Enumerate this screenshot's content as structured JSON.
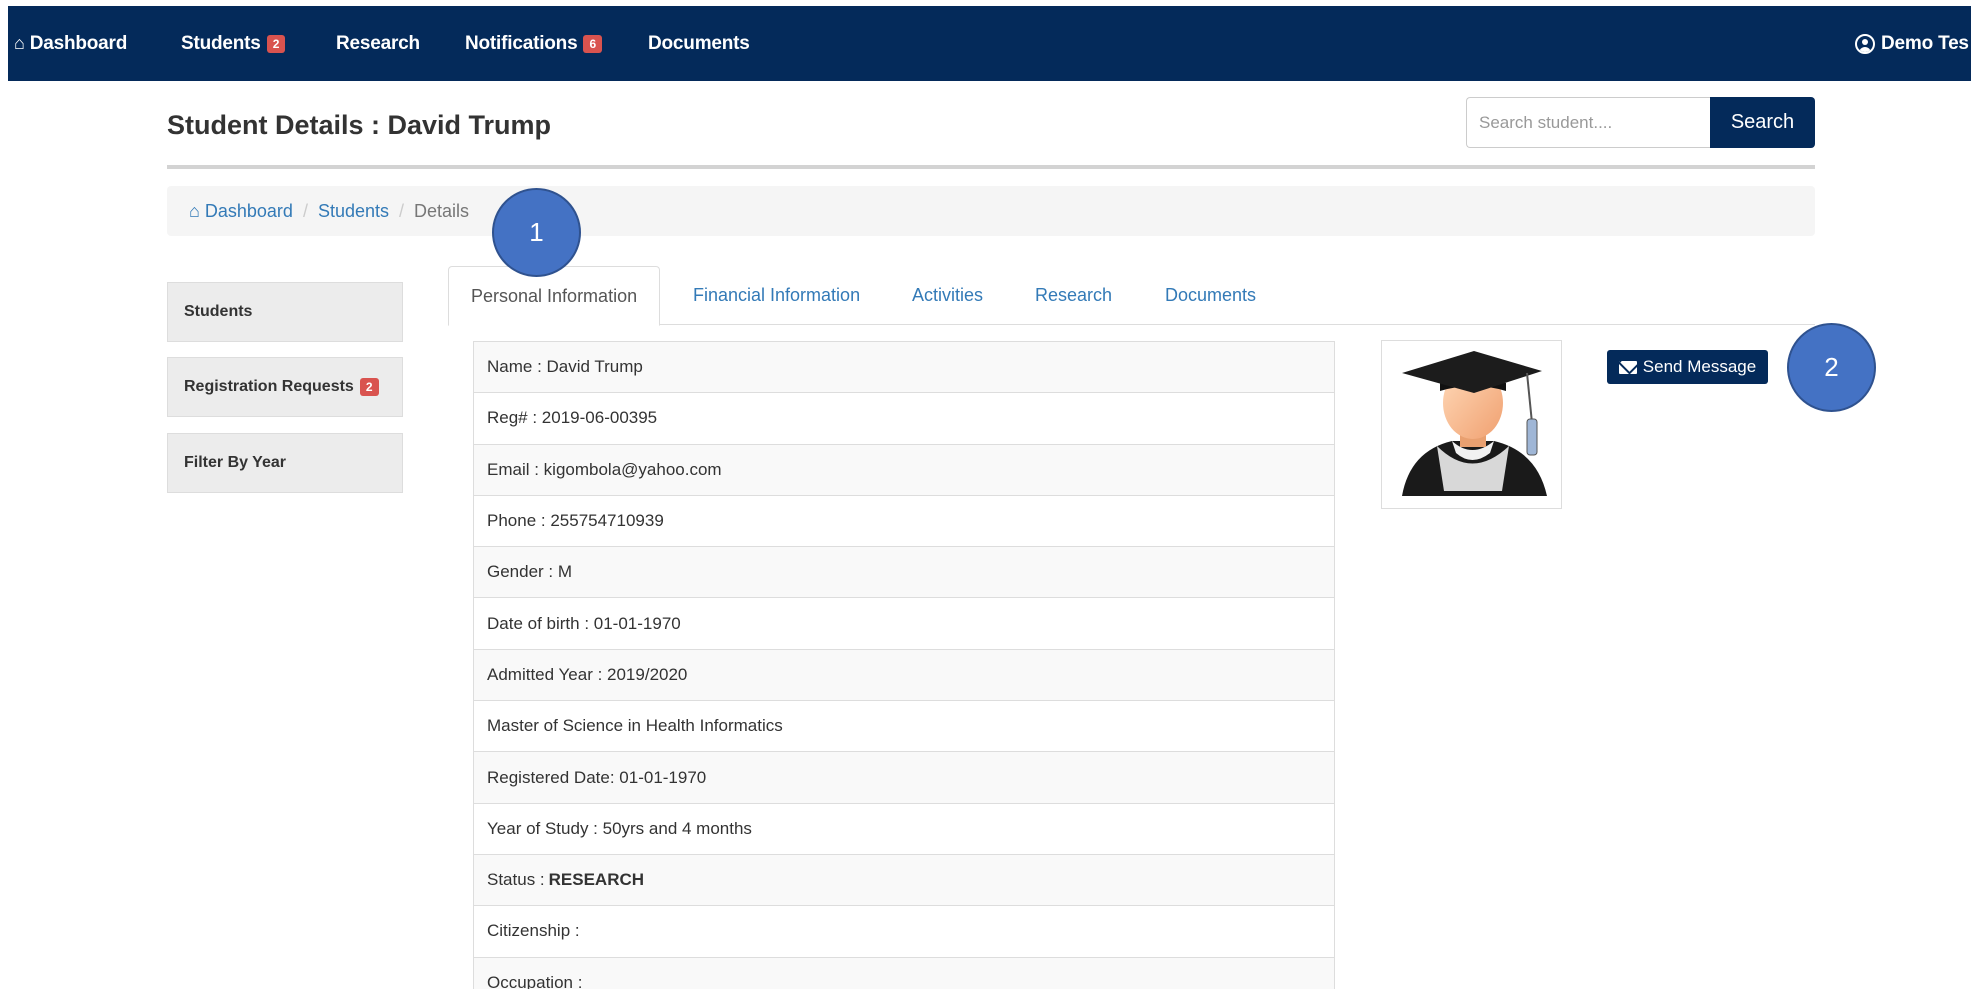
{
  "navbar": {
    "dashboard": "Dashboard",
    "students": "Students",
    "students_badge": "2",
    "research": "Research",
    "notifications": "Notifications",
    "notifications_badge": "6",
    "documents": "Documents",
    "user": "Demo Tes"
  },
  "header": {
    "title": "Student Details : David Trump",
    "search_placeholder": "Search student....",
    "search_button": "Search"
  },
  "breadcrumb": {
    "home": "Dashboard",
    "students": "Students",
    "current": "Details"
  },
  "sidebar": {
    "students": "Students",
    "registration_requests": "Registration Requests",
    "registration_badge": "2",
    "filter_by_year": "Filter By Year"
  },
  "tabs": {
    "personal": "Personal Information",
    "financial": "Financial Information",
    "activities": "Activities",
    "research": "Research",
    "documents": "Documents"
  },
  "info": {
    "name": "Name : David Trump",
    "reg": "Reg# : 2019-06-00395",
    "email": "Email : kigombola@yahoo.com",
    "phone": "Phone : 255754710939",
    "gender": "Gender : M",
    "dob": "Date of birth : 01-01-1970",
    "admitted": "Admitted Year : 2019/2020",
    "program": "Master of Science in Health Informatics",
    "registered": "Registered Date: 01-01-1970",
    "year_of_study": "Year of Study : 50yrs and 4 months",
    "status_label": "Status :",
    "status_value": "RESEARCH",
    "citizenship": "Citizenship :",
    "occupation": "Occupation :"
  },
  "actions": {
    "send_message": "Send Message"
  },
  "callouts": {
    "one": "1",
    "two": "2"
  },
  "colors": {
    "navbar": "#042a5a",
    "badge": "#d9534f",
    "link": "#337ab7",
    "callout": "#4472c4"
  }
}
